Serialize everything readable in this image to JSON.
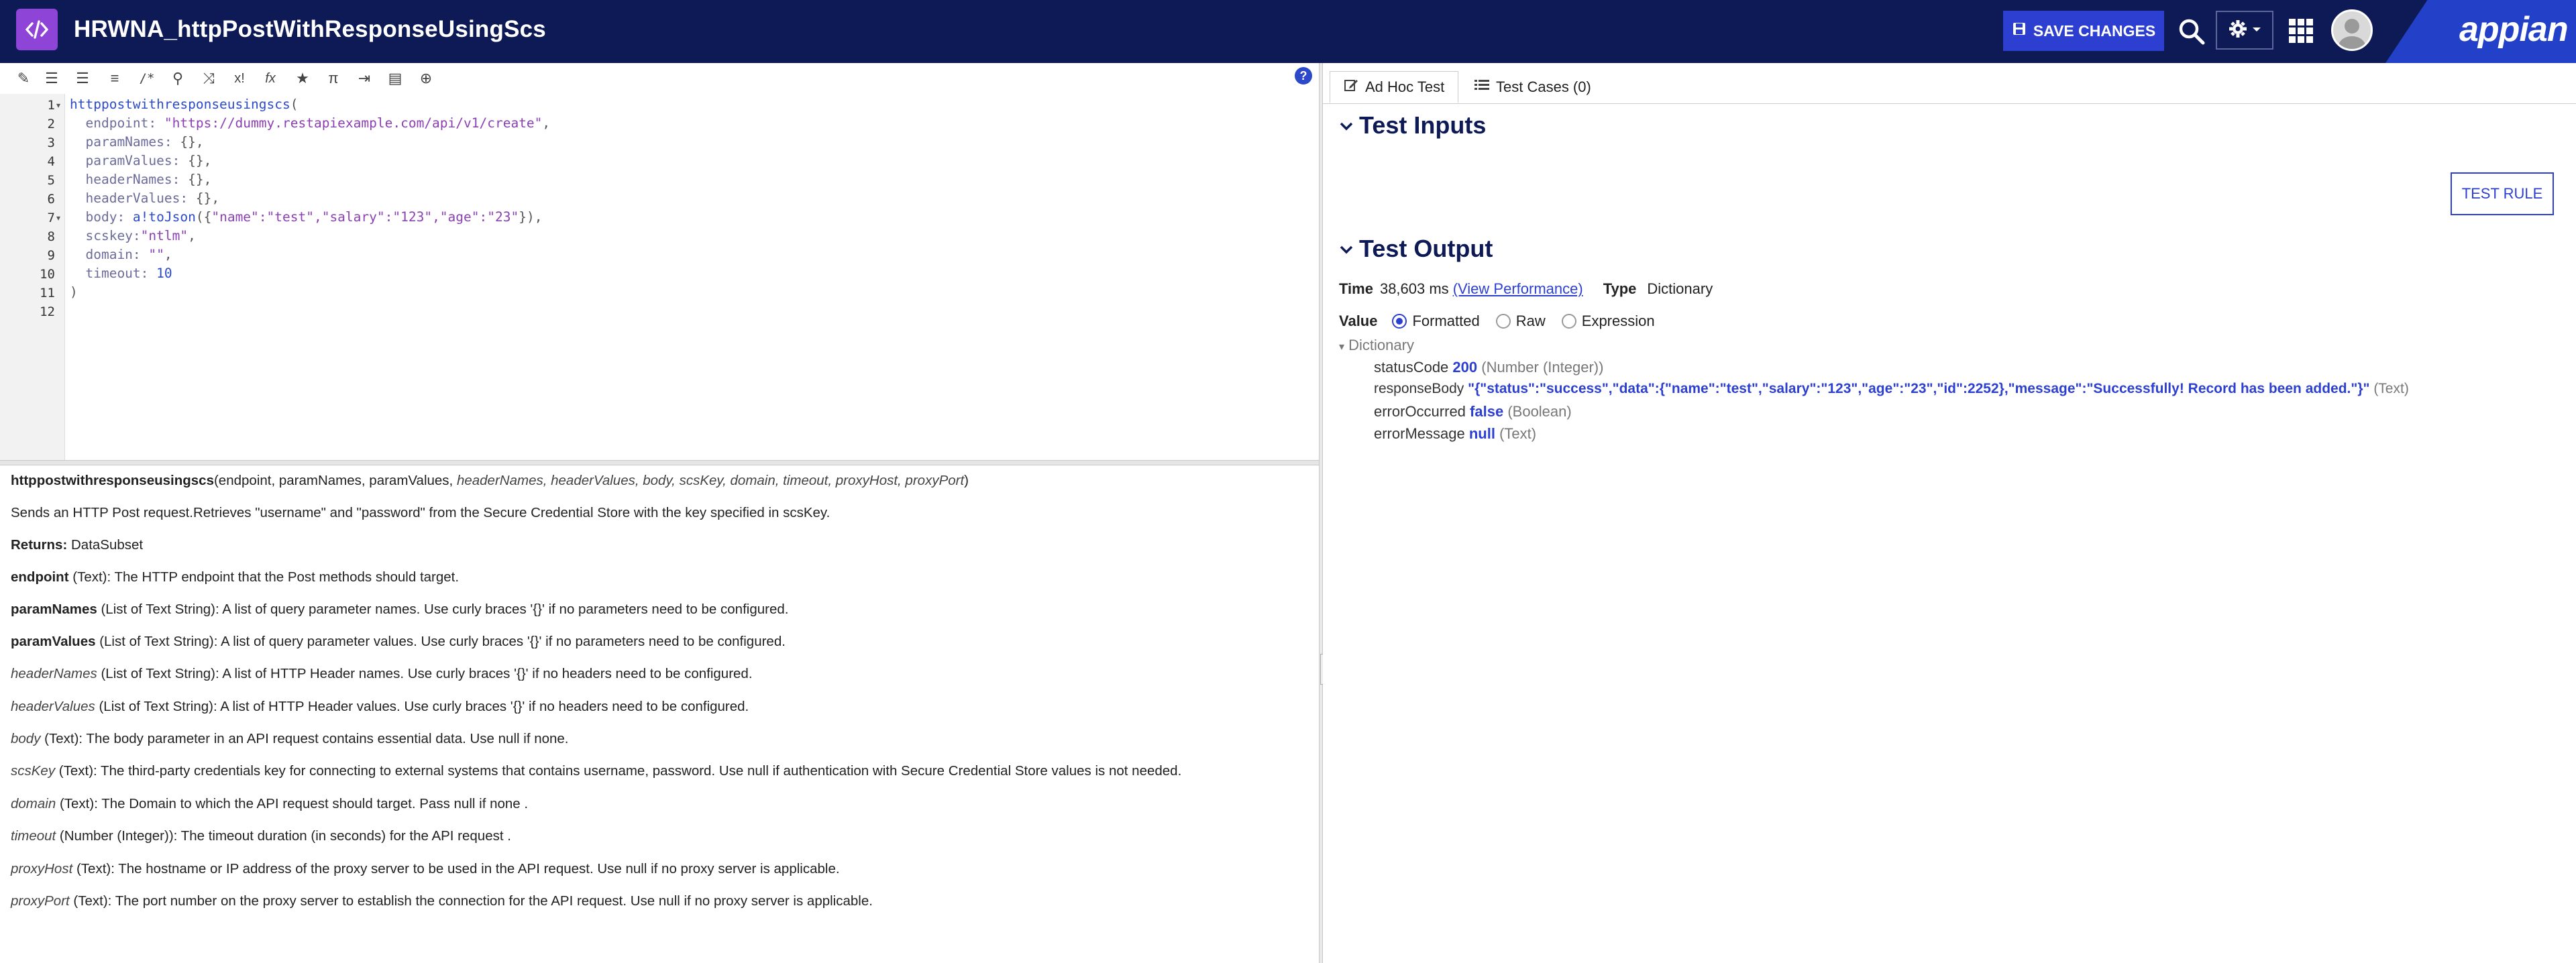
{
  "header": {
    "title": "HRWNA_httpPostWithResponseUsingScs",
    "save_label": "SAVE CHANGES",
    "brand": "appian"
  },
  "editor": {
    "line_numbers": [
      "1",
      "2",
      "3",
      "4",
      "5",
      "6",
      "7",
      "8",
      "9",
      "10",
      "11",
      "12"
    ],
    "lines": [
      {
        "indent": "",
        "fn": "httppostwithresponseusingscs",
        "rest": "("
      },
      {
        "indent": "  ",
        "key": "endpoint:",
        "str": " \"https://dummy.restapiexample.com/api/v1/create\"",
        "rest": ","
      },
      {
        "indent": "  ",
        "key": "paramNames:",
        "rest": " {},"
      },
      {
        "indent": "  ",
        "key": "paramValues:",
        "rest": " {},"
      },
      {
        "indent": "  ",
        "key": "headerNames:",
        "rest": " {},"
      },
      {
        "indent": "  ",
        "key": "headerValues:",
        "rest": " {},"
      },
      {
        "indent": "  ",
        "key": "body:",
        "fn2": " a!toJson",
        "rest2": "({",
        "str": "\"name\":\"test\",\"salary\":\"123\",\"age\":\"23\"",
        "rest": "}),"
      },
      {
        "indent": "  ",
        "key": "scskey:",
        "str": "\"ntlm\"",
        "rest": ","
      },
      {
        "indent": "  ",
        "key": "domain:",
        "str": " \"\"",
        "rest": ","
      },
      {
        "indent": "  ",
        "key": "timeout:",
        "num": " 10",
        "rest": ""
      },
      {
        "indent": "",
        "rest": ")"
      },
      {
        "indent": "",
        "rest": ""
      }
    ]
  },
  "docs": {
    "signature_fn": "httppostwithresponseusingscs",
    "signature_req": "(endpoint, paramNames, paramValues, ",
    "signature_opt": "headerNames, headerValues, body, scsKey, domain, timeout, proxyHost, proxyPort",
    "signature_end": ")",
    "description": "Sends an HTTP Post request.Retrieves \"username\" and \"password\" from the Secure Credential Store with the key specified in scsKey.",
    "returns_label": "Returns:",
    "returns_value": " DataSubset",
    "params": [
      {
        "name": "endpoint",
        "bold": true,
        "desc": " (Text): The HTTP endpoint that the Post methods should target."
      },
      {
        "name": "paramNames",
        "bold": true,
        "desc": " (List of Text String): A list of query parameter names. Use curly braces '{}' if no parameters need to be configured."
      },
      {
        "name": "paramValues",
        "bold": true,
        "desc": " (List of Text String): A list of query parameter values. Use curly braces '{}' if no parameters need to be configured."
      },
      {
        "name": "headerNames",
        "bold": false,
        "desc": " (List of Text String): A list of HTTP Header names. Use curly braces '{}' if no headers need to be configured."
      },
      {
        "name": "headerValues",
        "bold": false,
        "desc": " (List of Text String): A list of HTTP Header values. Use curly braces '{}' if no headers need to be configured."
      },
      {
        "name": "body",
        "bold": false,
        "desc": " (Text): The body parameter in an API request contains essential data. Use null if none."
      },
      {
        "name": "scsKey",
        "bold": false,
        "desc": " (Text): The third-party credentials key for connecting to external systems that contains username, password. Use null if authentication with Secure Credential Store values is not needed."
      },
      {
        "name": "domain",
        "bold": false,
        "desc": " (Text): The Domain to which the API request should target. Pass null if none ."
      },
      {
        "name": "timeout",
        "bold": false,
        "desc": " (Number (Integer)): The timeout duration (in seconds) for the API request ."
      },
      {
        "name": "proxyHost",
        "bold": false,
        "desc": " (Text): The hostname or IP address of the proxy server to be used in the API request. Use null if no proxy server is applicable."
      },
      {
        "name": "proxyPort",
        "bold": false,
        "desc": " (Text): The port number on the proxy server to establish the connection for the API request. Use null if no proxy server is applicable."
      }
    ]
  },
  "right": {
    "tabs": [
      {
        "label": "Ad Hoc Test",
        "active": true
      },
      {
        "label": "Test Cases (0)",
        "active": false
      }
    ],
    "test_inputs_title": "Test Inputs",
    "test_rule_label": "TEST RULE",
    "test_output_title": "Test Output",
    "time_label": "Time",
    "time_value": "38,603 ms",
    "view_performance": "(View Performance)",
    "type_label": "Type",
    "type_value": "Dictionary",
    "value_label": "Value",
    "value_options": [
      "Formatted",
      "Raw",
      "Expression"
    ],
    "value_selected": "Formatted",
    "tree_root": "Dictionary",
    "fields": [
      {
        "name": "statusCode",
        "value": "200",
        "type": "(Number (Integer))"
      },
      {
        "name": "responseBody",
        "value": "\"{\"status\":\"success\",\"data\":{\"name\":\"test\",\"salary\":\"123\",\"age\":\"23\",\"id\":2252},\"message\":\"Successfully! Record has been added.\"}\"",
        "type": "(Text)"
      },
      {
        "name": "errorOccurred",
        "value": "false",
        "type": "(Boolean)"
      },
      {
        "name": "errorMessage",
        "value": "null",
        "type": "(Text)"
      }
    ]
  }
}
